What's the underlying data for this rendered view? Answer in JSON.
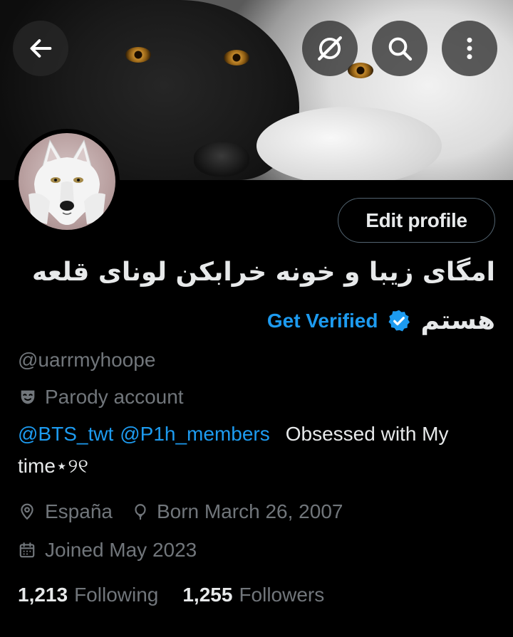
{
  "header": {
    "back_icon": "arrow-left-icon",
    "icons": [
      "grok-slash-icon",
      "search-icon",
      "more-vertical-icon"
    ]
  },
  "profile": {
    "edit_label": "Edit profile",
    "name_line1": "امگای زیبا و خونه خرابکن لونای قلعه",
    "name_line2": "هستم",
    "get_verified_label": "Get Verified",
    "handle": "@uarrmyhoope",
    "parody_label": "Parody account",
    "bio": {
      "mention1": "@BTS_twt",
      "mention2": "@P1h_members",
      "text_line1": "Obsessed with My",
      "text_line2": "time⋆୨୧"
    },
    "location": "España",
    "birthday": "Born March 26, 2007",
    "joined": "Joined May 2023",
    "following_count": "1,213",
    "following_label": "Following",
    "followers_count": "1,255",
    "followers_label": "Followers"
  },
  "colors": {
    "background": "#000000",
    "text": "#e7e9ea",
    "muted": "#71767b",
    "accent": "#1d9bf0",
    "border": "#536471"
  }
}
